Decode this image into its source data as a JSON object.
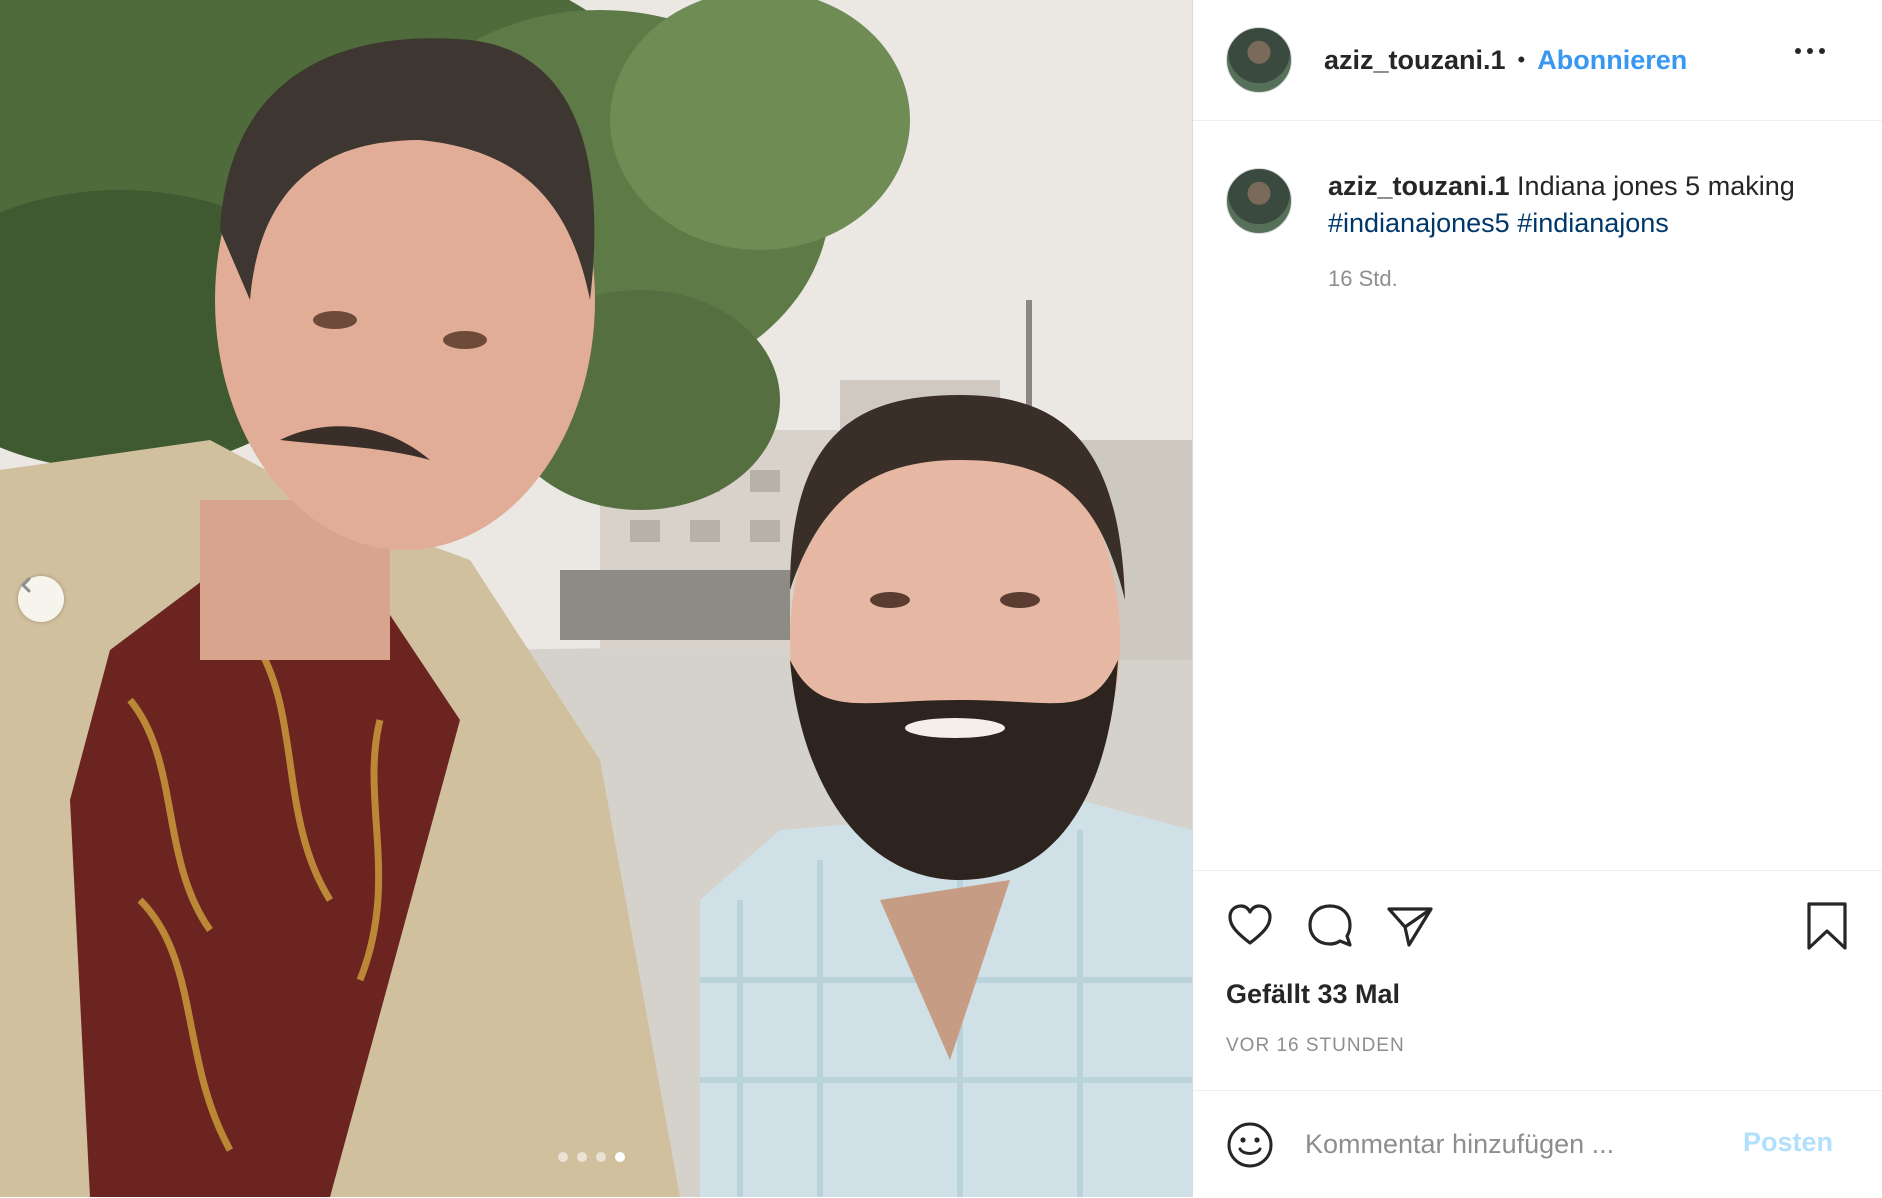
{
  "post": {
    "username": "aziz_touzani.1",
    "separator": "•",
    "follow_label": "Abonnieren",
    "more_icon": "more-horizontal-icon"
  },
  "caption": {
    "username": "aziz_touzani.1",
    "text": " Indiana jones 5 making",
    "hashtags": [
      "#indianajones5",
      "#indianajons"
    ],
    "time": "16 Std."
  },
  "actions": {
    "icons": [
      "heart-icon",
      "comment-icon",
      "share-icon",
      "bookmark-icon"
    ]
  },
  "likes": "Gefällt 33 Mal",
  "date": "VOR 16 STUNDEN",
  "comment": {
    "placeholder": "Kommentar hinzufügen ...",
    "post_label": "Posten"
  },
  "carousel": {
    "slide_count": 4,
    "active_slide": 4
  },
  "colors": {
    "accent": "#3897f0",
    "hashtag": "#00376b",
    "post_disabled": "#b2dffc",
    "muted": "#8e8e8e"
  }
}
